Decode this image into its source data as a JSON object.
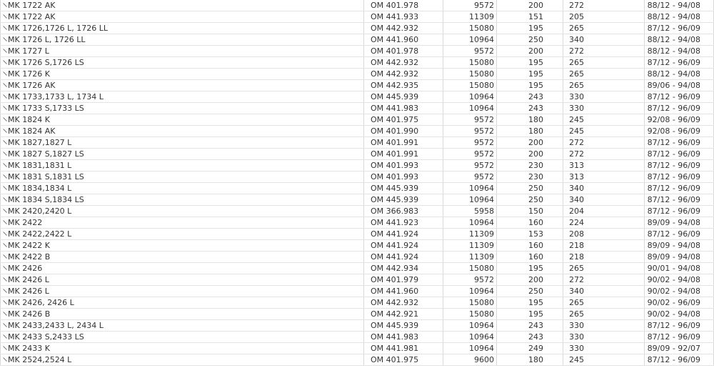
{
  "rows": [
    {
      "model": "MK 1722 AK",
      "engine": "OM 401.978",
      "ccm": "9572",
      "kw": "200",
      "hp": "272",
      "years": "88/12 - 94/08"
    },
    {
      "model": "MK 1722 AK",
      "engine": "OM 441.933",
      "ccm": "11309",
      "kw": "151",
      "hp": "205",
      "years": "88/12 - 94/08"
    },
    {
      "model": "MK 1726,1726 L, 1726 LL",
      "engine": "OM 442.932",
      "ccm": "15080",
      "kw": "195",
      "hp": "265",
      "years": "87/12 - 96/09"
    },
    {
      "model": "MK 1726 L, 1726 LL",
      "engine": "OM 441.960",
      "ccm": "10964",
      "kw": "250",
      "hp": "340",
      "years": "88/12 - 94/08"
    },
    {
      "model": "MK 1727 L",
      "engine": "OM 401.978",
      "ccm": "9572",
      "kw": "200",
      "hp": "272",
      "years": "88/12 - 94/08"
    },
    {
      "model": "MK 1726 S,1726 LS",
      "engine": "OM 442.932",
      "ccm": "15080",
      "kw": "195",
      "hp": "265",
      "years": "87/12 - 96/09"
    },
    {
      "model": "MK 1726 K",
      "engine": "OM 442.932",
      "ccm": "15080",
      "kw": "195",
      "hp": "265",
      "years": "88/12 - 94/08"
    },
    {
      "model": "MK 1726 AK",
      "engine": "OM 442.935",
      "ccm": "15080",
      "kw": "195",
      "hp": "265",
      "years": "89/06 - 94/08"
    },
    {
      "model": "MK 1733,1733 L, 1734 L",
      "engine": "OM 445.939",
      "ccm": "10964",
      "kw": "243",
      "hp": "330",
      "years": "87/12 - 96/09"
    },
    {
      "model": "MK 1733 S,1733 LS",
      "engine": "OM 441.983",
      "ccm": "10964",
      "kw": "243",
      "hp": "330",
      "years": "87/12 - 96/09"
    },
    {
      "model": "MK 1824 K",
      "engine": "OM 401.975",
      "ccm": "9572",
      "kw": "180",
      "hp": "245",
      "years": "92/08 - 96/09"
    },
    {
      "model": "MK 1824 AK",
      "engine": "OM 401.990",
      "ccm": "9572",
      "kw": "180",
      "hp": "245",
      "years": "92/08 - 96/09"
    },
    {
      "model": "MK 1827,1827 L",
      "engine": "OM 401.991",
      "ccm": "9572",
      "kw": "200",
      "hp": "272",
      "years": "87/12 - 96/09"
    },
    {
      "model": "MK 1827 S,1827 LS",
      "engine": "OM 401.991",
      "ccm": "9572",
      "kw": "200",
      "hp": "272",
      "years": "87/12 - 96/09"
    },
    {
      "model": "MK 1831,1831 L",
      "engine": "OM 401.993",
      "ccm": "9572",
      "kw": "230",
      "hp": "313",
      "years": "87/12 - 96/09"
    },
    {
      "model": "MK 1831 S,1831 LS",
      "engine": "OM 401.993",
      "ccm": "9572",
      "kw": "230",
      "hp": "313",
      "years": "87/12 - 96/09"
    },
    {
      "model": "MK 1834,1834 L",
      "engine": "OM 445.939",
      "ccm": "10964",
      "kw": "250",
      "hp": "340",
      "years": "87/12 - 96/09"
    },
    {
      "model": "MK 1834 S,1834 LS",
      "engine": "OM 445.939",
      "ccm": "10964",
      "kw": "250",
      "hp": "340",
      "years": "87/12 - 96/09"
    },
    {
      "model": "MK 2420,2420 L",
      "engine": "OM 366.983",
      "ccm": "5958",
      "kw": "150",
      "hp": "204",
      "years": "87/12 - 96/09"
    },
    {
      "model": "MK 2422",
      "engine": "OM 441.923",
      "ccm": "10964",
      "kw": "160",
      "hp": "224",
      "years": "89/09 - 94/08"
    },
    {
      "model": "MK 2422,2422 L",
      "engine": "OM 441.924",
      "ccm": "11309",
      "kw": "153",
      "hp": "208",
      "years": "87/12 - 96/09"
    },
    {
      "model": "MK 2422 K",
      "engine": "OM 441.924",
      "ccm": "11309",
      "kw": "160",
      "hp": "218",
      "years": "89/09 - 94/08"
    },
    {
      "model": "MK 2422 B",
      "engine": "OM 441.924",
      "ccm": "11309",
      "kw": "160",
      "hp": "218",
      "years": "89/09 - 94/08"
    },
    {
      "model": "MK 2426",
      "engine": "OM 442.934",
      "ccm": "15080",
      "kw": "195",
      "hp": "265",
      "years": "90/01 - 94/08"
    },
    {
      "model": "MK 2426 L",
      "engine": "OM 401.979",
      "ccm": "9572",
      "kw": "200",
      "hp": "272",
      "years": "90/02 - 94/08"
    },
    {
      "model": "MK 2426 L",
      "engine": "OM 441.960",
      "ccm": "10964",
      "kw": "250",
      "hp": "340",
      "years": "90/02 - 94/08"
    },
    {
      "model": "MK 2426, 2426 L",
      "engine": "OM 442.932",
      "ccm": "15080",
      "kw": "195",
      "hp": "265",
      "years": "90/02 - 96/09"
    },
    {
      "model": "MK 2426 B",
      "engine": "OM 442.921",
      "ccm": "15080",
      "kw": "195",
      "hp": "265",
      "years": "90/02 - 94/08"
    },
    {
      "model": "MK 2433,2433 L, 2434 L",
      "engine": "OM 445.939",
      "ccm": "10964",
      "kw": "243",
      "hp": "330",
      "years": "87/12 - 96/09"
    },
    {
      "model": "MK 2433 S,2433 LS",
      "engine": "OM 441.983",
      "ccm": "10964",
      "kw": "243",
      "hp": "330",
      "years": "87/12 - 96/09"
    },
    {
      "model": "MK 2433 K",
      "engine": "OM 441.981",
      "ccm": "10964",
      "kw": "249",
      "hp": "330",
      "years": "89/09 - 92/07"
    },
    {
      "model": "MK 2524,2524 L",
      "engine": "OM 401.975",
      "ccm": "9600",
      "kw": "180",
      "hp": "245",
      "years": "87/12 - 96/09"
    }
  ]
}
